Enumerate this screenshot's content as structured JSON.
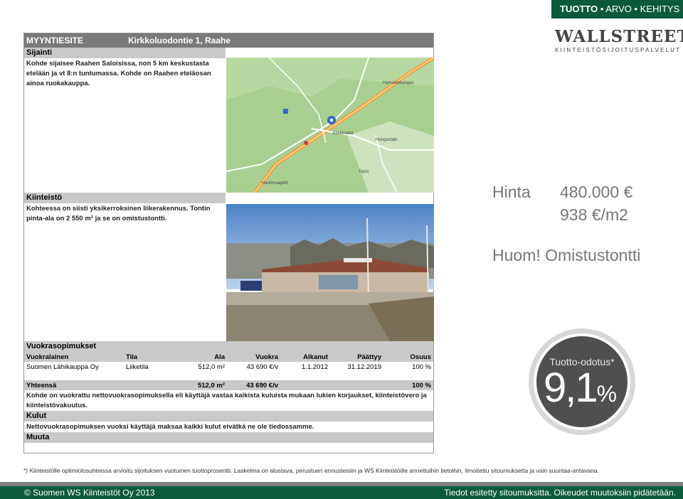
{
  "topbar": {
    "part1": "TUOTTO",
    "part2": " • ARVO • KEHITYS"
  },
  "logo": {
    "main": "WALLSTREET",
    "sub": "KIINTEISTÖSIJOITUSPALVELUT",
    "mark": "©"
  },
  "doc": {
    "header_left": "MYYNTIESITE",
    "header_right": "Kirkkoluodontie 1, Raahe",
    "sijainti_title": "Sijainti",
    "sijainti_text": "Kohde sijaisee Raahen Saloisissa, non 5 km keskustasta etelään ja vt 8:n tuntumassa. Kohde on Raahen eteläosan ainoa ruokakauppa.",
    "map_labels": [
      "Hamulankangas",
      "Hangastalo",
      "Tapio",
      "Hanhinsapirtti",
      "Kiiskinlahti"
    ],
    "kiinteisto_title": "Kiinteistö",
    "kiinteisto_text": "Kohteessa on siisti yksikerroksinen liikerakennus. Tontin pinta-ala on 2 550 m² ja se on omistustontti.",
    "vuokra_title": "Vuokrasopimukset",
    "lease_headers": [
      "Vuokralainen",
      "Tila",
      "Ala",
      "Vuokra",
      "Alkanut",
      "Päättyy",
      "Osuus"
    ],
    "lease_row": [
      "Suomen Lähikauppa Oy",
      "Liiketila",
      "512,0 m²",
      "43 690 €/v",
      "1.1.2012",
      "31.12.2019",
      "100 %"
    ],
    "total_row": [
      "Yhteensä",
      "",
      "512,0 m²",
      "43 690 €/v",
      "",
      "",
      "100 %"
    ],
    "lease_note": "Kohde on vuokrattu nettovuokrasopimuksella eli käyttäjä vastaa kaikista kuluista mukaan lukien korjaukset, kiinteistövero ja kiinteistövakuutus.",
    "kulut_title": "Kulut",
    "kulut_text": "Nettovuokrasopimuksen vuoksi käyttäjä maksaa kaikki kulut eivätkä ne ole tiedossamme.",
    "muuta_title": "Muuta"
  },
  "price": {
    "label": "Hinta",
    "value": "480.000 €",
    "per_m2": "938 €/m2"
  },
  "note": "Huom! Omistustontti",
  "badge": {
    "label": "Tuotto-odotus*",
    "value": "9,1",
    "unit": "%"
  },
  "footnote": "*) Kiinteistölle optimiolosuhteissa arvioitu sijoituksen vuotuinen tuottoprosentti. Laskelma on alustava, perustuen ennusteisiin ja WS Kiinteistöille annettuihin tietoihin, ilmoitettu sitoumuksetta ja vain suuntaa-antavana.",
  "footer": {
    "left": "© Suomen WS Kiinteistöt Oy 2013",
    "right": "Tiedot esitetty sitoumuksitta. Oikeudet muutoksiin pidätetään."
  },
  "colors": {
    "brand_green": "#0b5b3b",
    "badge_dark": "#4f4f4f",
    "price_gray": "#777777"
  }
}
